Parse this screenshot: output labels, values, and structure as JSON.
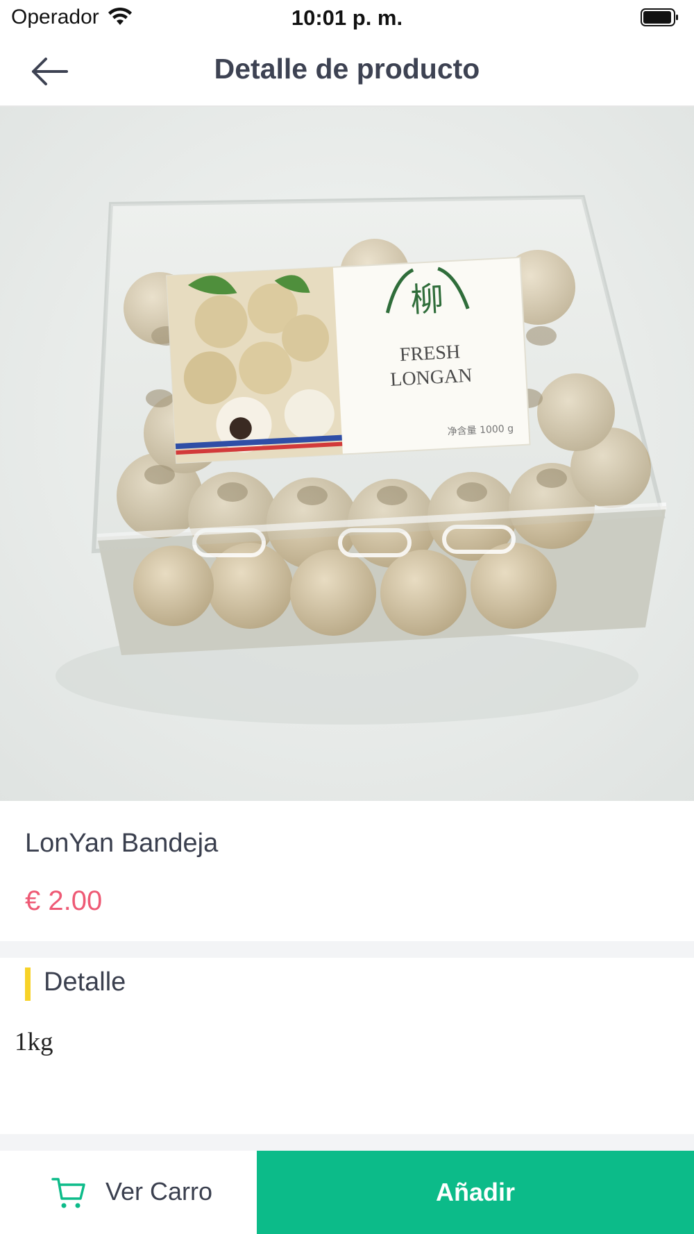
{
  "status_bar": {
    "carrier": "Operador",
    "time": "10:01 p. m."
  },
  "header": {
    "title": "Detalle de producto",
    "back_icon": "arrow-left-icon"
  },
  "product": {
    "image_label_line1": "FRESH",
    "image_label_line2": "LONGAN",
    "image_label_seal": "柳",
    "image_label_weight": "净含量 1000 g",
    "name": "LonYan Bandeja",
    "price": "€ 2.00"
  },
  "detail": {
    "title": "Detalle",
    "body": "1kg"
  },
  "bottom_bar": {
    "cart_label": "Ver Carro",
    "cart_icon": "shopping-cart-icon",
    "add_label": "Añadir"
  },
  "colors": {
    "price": "#ee5a75",
    "accent_green": "#0cbb89",
    "detail_marker": "#f7d227",
    "title_text": "#3d4252"
  }
}
